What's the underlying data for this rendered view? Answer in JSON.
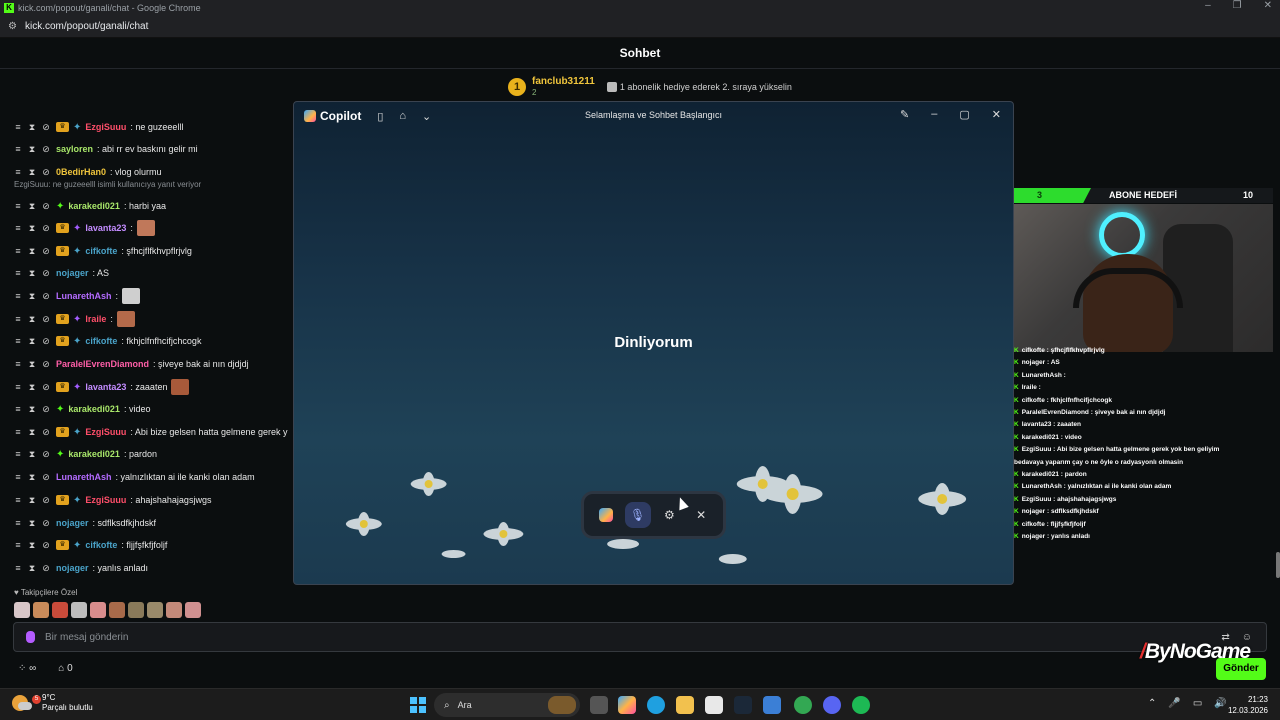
{
  "browser": {
    "title": "kick.com/popout/ganali/chat - Google Chrome",
    "url": "kick.com/popout/ganali/chat"
  },
  "chat": {
    "header": "Sohbet",
    "pinned": {
      "rank": "1",
      "username": "fanclub31211",
      "sub_count": "2",
      "goal_text": "1 abonelik hediye ederek 2. sıraya yükselin"
    },
    "reply_notice": "EzgiSuuu: ne guzeeelll isimli kullanıcıya yanıt veriyor",
    "messages": [
      {
        "user": "EzgiSuuu",
        "text": ": ne guzeeelll",
        "color": "#ff4f6a",
        "crown": true,
        "gem": "blue"
      },
      {
        "user": "sayloren",
        "text": ": abi rr ev baskını gelir mi",
        "color": "#a8e66a",
        "crown": false,
        "gem": ""
      },
      {
        "user": "0BedirHan0",
        "text": ": vlog olurmu",
        "color": "#f0c53c",
        "crown": false,
        "gem": ""
      },
      {
        "user": "karakedi021",
        "text": ": harbi yaa",
        "color": "#a8e66a",
        "crown": false,
        "gem": "green"
      },
      {
        "user": "lavanta23",
        "text": ":",
        "color": "#c38cff",
        "crown": true,
        "gem": "purple"
      },
      {
        "user": "cifkofte",
        "text": ": şfhcjflfkhvpflrjvlg",
        "color": "#4aa3c9",
        "crown": true,
        "gem": "blue"
      },
      {
        "user": "nojager",
        "text": ": AS",
        "color": "#4aa3c9",
        "crown": false,
        "gem": ""
      },
      {
        "user": "LunarethAsh",
        "text": ":",
        "color": "#b46bff",
        "crown": false,
        "gem": ""
      },
      {
        "user": "lraile",
        "text": ":",
        "color": "#ff4f6a",
        "crown": true,
        "gem": "purple"
      },
      {
        "user": "cifkofte",
        "text": ": fkhjclfnfhcifjchcogk",
        "color": "#4aa3c9",
        "crown": true,
        "gem": "blue"
      },
      {
        "user": "ParalelEvrenDiamond",
        "text": ": şiveye bak ai nın djdjdj",
        "color": "#ff5fa8",
        "crown": false,
        "gem": ""
      },
      {
        "user": "lavanta23",
        "text": ": zaaaten",
        "color": "#c38cff",
        "crown": true,
        "gem": "purple"
      },
      {
        "user": "karakedi021",
        "text": ": video",
        "color": "#a8e66a",
        "crown": false,
        "gem": "green"
      },
      {
        "user": "EzgiSuuu",
        "text": ": Abi bize gelsen hatta gelmene gerek y",
        "color": "#ff4f6a",
        "crown": true,
        "gem": "blue"
      },
      {
        "user": "karakedi021",
        "text": ": pardon",
        "color": "#a8e66a",
        "crown": false,
        "gem": "green"
      },
      {
        "user": "LunarethAsh",
        "text": ": yalnızlıktan ai ile kanki olan adam",
        "color": "#b46bff",
        "crown": false,
        "gem": ""
      },
      {
        "user": "EzgiSuuu",
        "text": ": ahajshahajagsjwgs",
        "color": "#ff4f6a",
        "crown": true,
        "gem": "blue"
      },
      {
        "user": "nojager",
        "text": ": sdflksdfkjhdskf",
        "color": "#4aa3c9",
        "crown": false,
        "gem": ""
      },
      {
        "user": "cifkofte",
        "text": ": fljjfşfkfjfoljf",
        "color": "#4aa3c9",
        "crown": true,
        "gem": "blue"
      },
      {
        "user": "nojager",
        "text": ": yanlıs anladı",
        "color": "#4aa3c9",
        "crown": false,
        "gem": ""
      }
    ],
    "followers_label": "Takipçilere Özel",
    "input_placeholder": "Bir mesaj gönderin",
    "bottom_count": "0",
    "send_label": "Gönder"
  },
  "overlay": {
    "goal_left": "3",
    "goal_title": "ABONE HEDEFİ",
    "goal_right": "10",
    "goal_progress": 0.3,
    "watermark": "ByNoGame",
    "chat_lines": [
      "cifkofte : şfhcjflfkhvpflrjvlg",
      "nojager : AS",
      "LunarethAsh :",
      "lraile :",
      "cifkofte : fkhjclfnfhcifjchcogk",
      "ParalelEvrenDiamond : şiveye bak ai nın djdjdj",
      "lavanta23 : zaaaten",
      "karakedi021 : video",
      "EzgiSuuu : Abi bize gelsen hatta gelmene gerek yok ben geliyim",
      "bedavaya yaparım çay o ne öyle o radyasyonlı olmasin",
      "karakedi021 : pardon",
      "LunarethAsh : yalnızlıktan ai ile kanki olan adam",
      "EzgiSuuu : ahajshahajagsjwgs",
      "nojager : sdflksdfkjhdskf",
      "cifkofte : fljjfşfkfjfoljf",
      "nojager : yanlıs anladı"
    ]
  },
  "copilot": {
    "app_name": "Copilot",
    "window_title": "Selamlaşma ve Sohbet Başlangıcı",
    "status": "Dinliyorum"
  },
  "taskbar": {
    "temperature": "9°C",
    "weather": "Parçalı bulutlu",
    "weather_badge": "5",
    "search_label": "Ara",
    "time": "21:23",
    "date": "12.03.2026"
  },
  "colors": {
    "kick_green": "#53fc18",
    "copilot_bg": "#173247"
  }
}
